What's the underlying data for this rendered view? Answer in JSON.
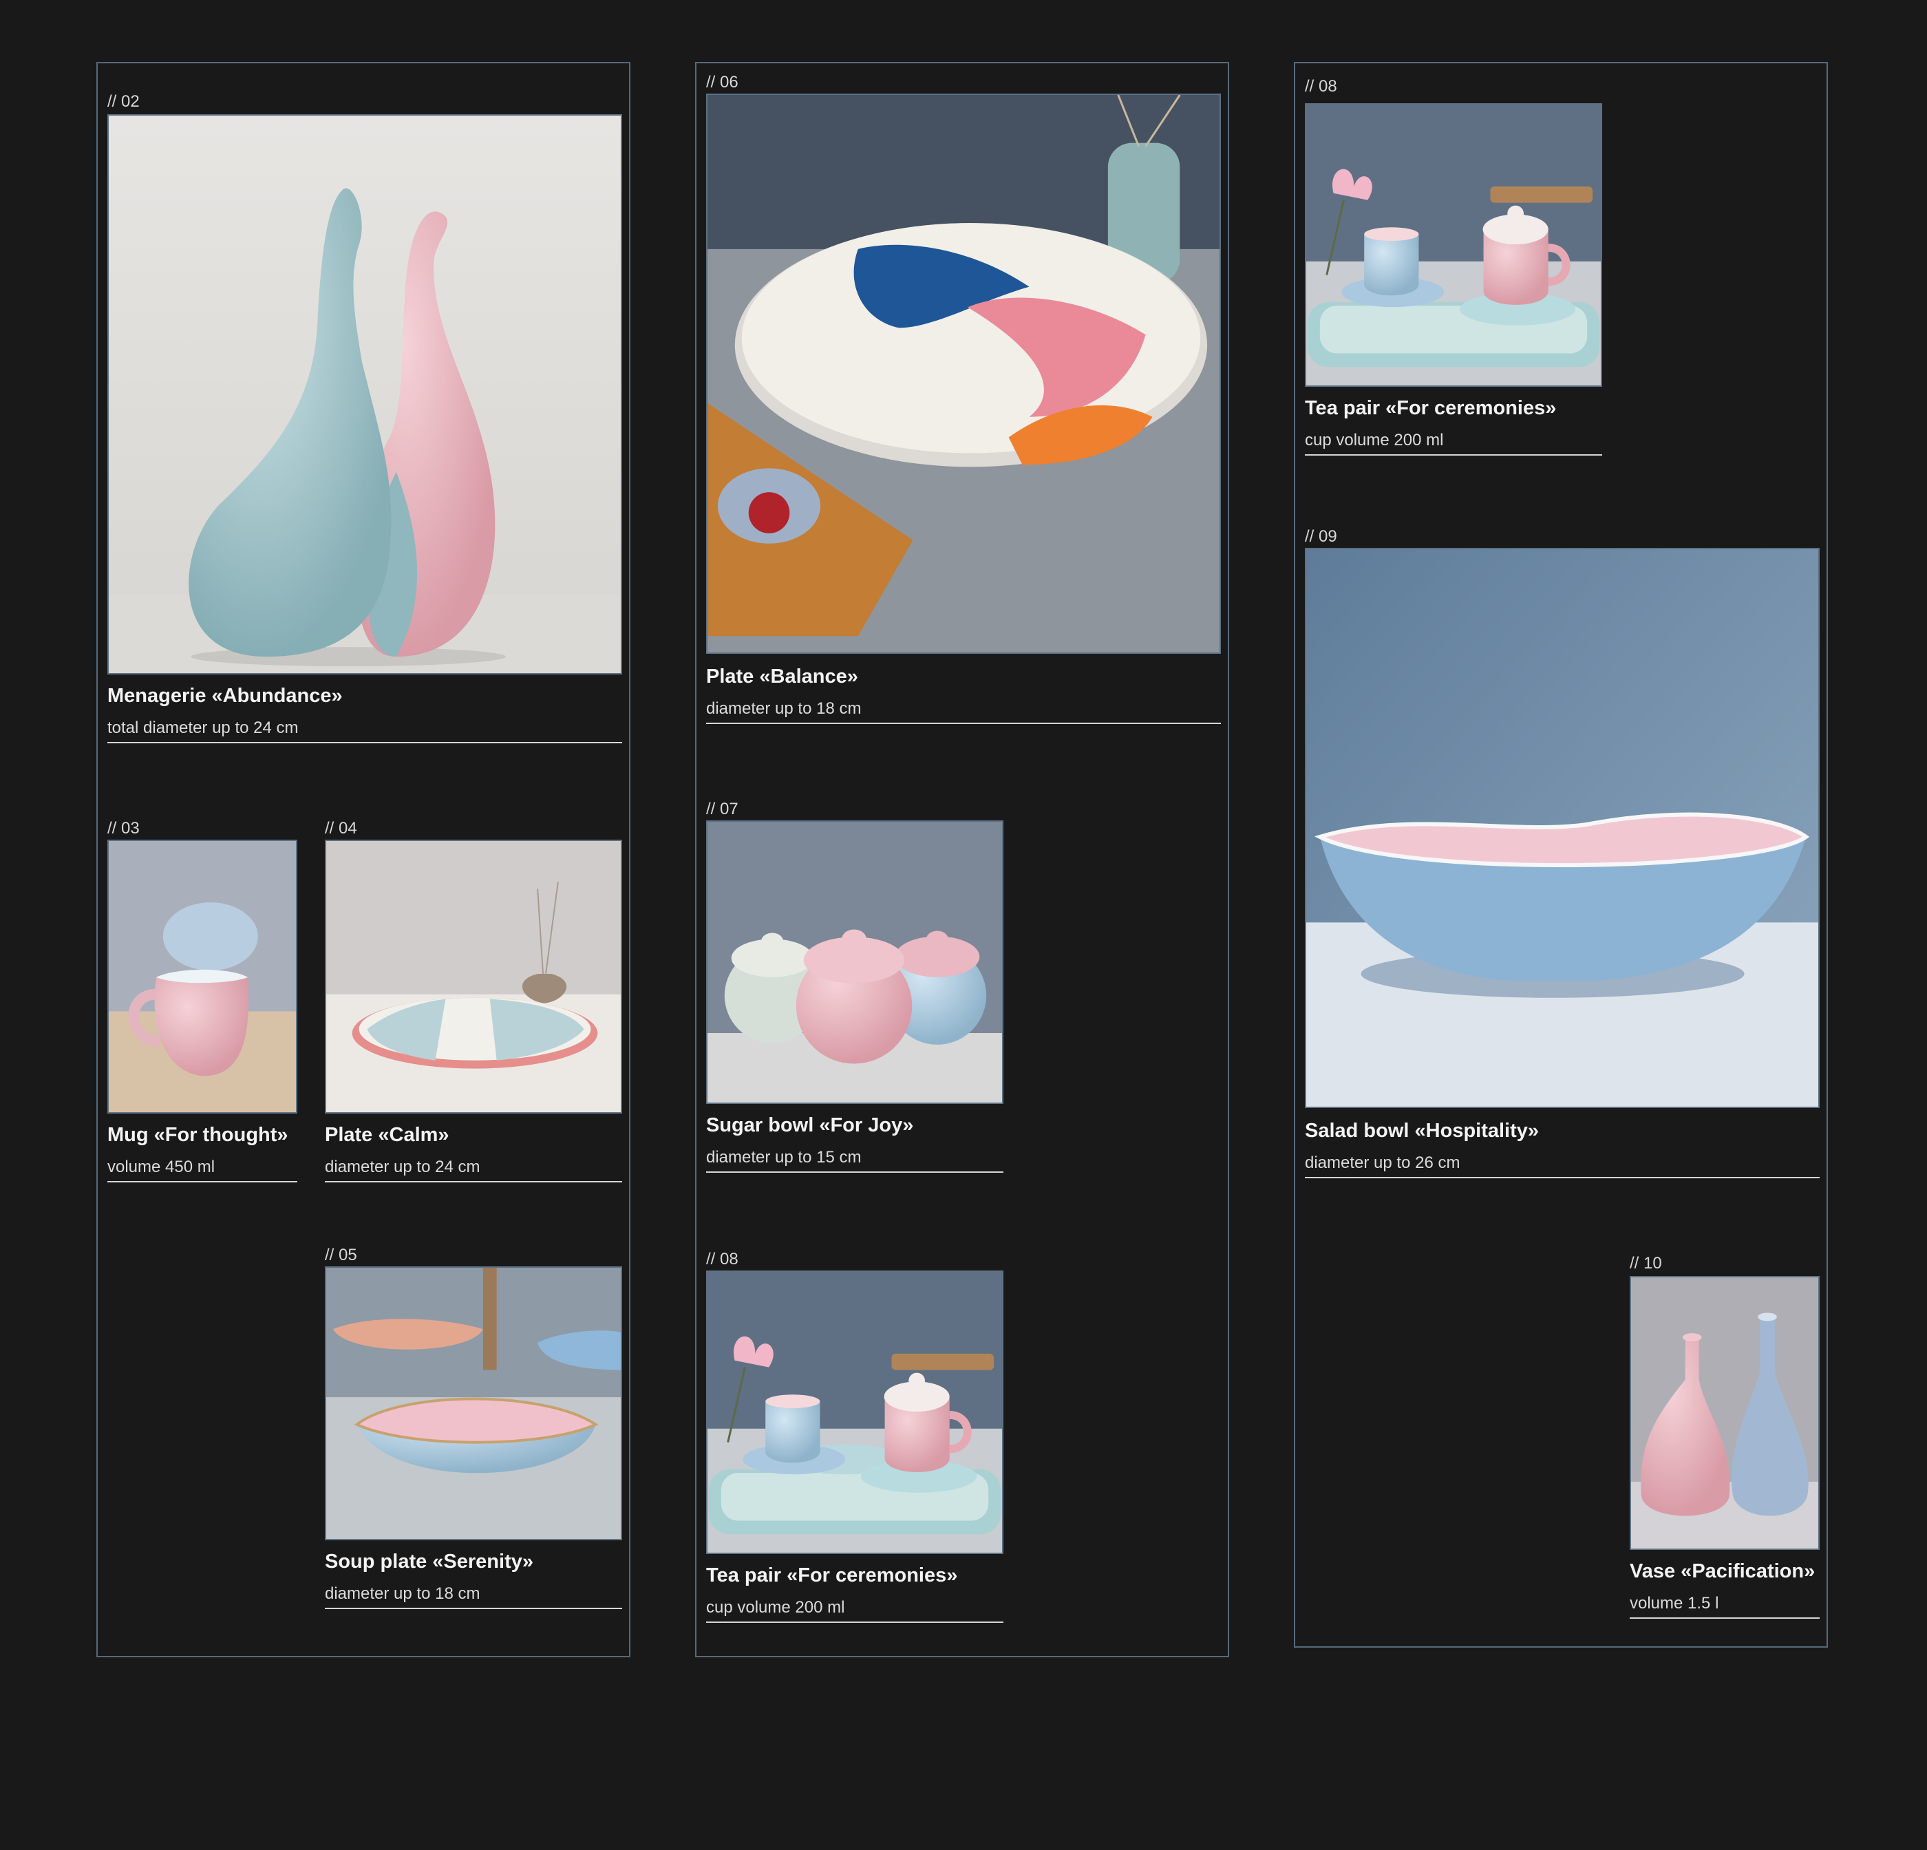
{
  "columns": [
    {
      "cards": [
        {
          "number": "// 02",
          "title": "Menagerie «Abundance»",
          "subtitle": "total diameter up to 24 cm",
          "image": "menagerie-figurines-image"
        },
        {
          "number": "// 03",
          "title": "Mug «For thought»",
          "subtitle": "volume 450 ml",
          "image": "mug-image"
        },
        {
          "number": "// 04",
          "title": "Plate «Calm»",
          "subtitle": "diameter up to 24 cm",
          "image": "plate-calm-image"
        },
        {
          "number": "// 05",
          "title": "Soup plate «Serenity»",
          "subtitle": "diameter up to 18 cm",
          "image": "soup-plate-image"
        }
      ]
    },
    {
      "cards": [
        {
          "number": "// 06",
          "title": "Plate «Balance»",
          "subtitle": "diameter up to 18 cm",
          "image": "plate-balance-image"
        },
        {
          "number": "// 07",
          "title": "Sugar bowl «For Joy»",
          "subtitle": "diameter up to 15 cm",
          "image": "sugar-bowl-image"
        },
        {
          "number": "// 08",
          "title": "Tea pair «For ceremonies»",
          "subtitle": "cup volume 200 ml",
          "image": "tea-pair-image"
        }
      ]
    },
    {
      "cards": [
        {
          "number": "// 08",
          "title": "Tea pair «For ceremonies»",
          "subtitle": "cup volume 200 ml",
          "image": "tea-pair-image"
        },
        {
          "number": "// 09",
          "title": "Salad bowl «Hospitality»",
          "subtitle": "diameter up to 26 cm",
          "image": "salad-bowl-image"
        },
        {
          "number": "// 10",
          "title": "Vase «Pacification»",
          "subtitle": "volume 1.5 l",
          "image": "vase-image"
        }
      ]
    }
  ]
}
